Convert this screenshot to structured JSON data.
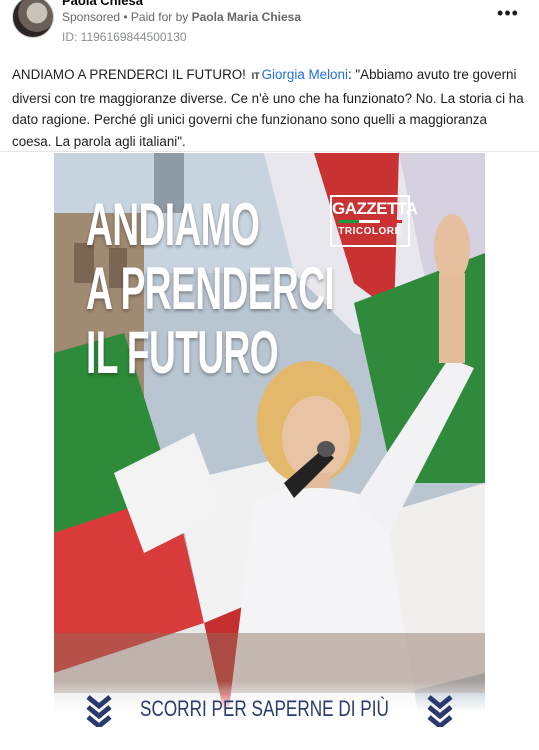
{
  "post": {
    "author": "Paola Chiesa",
    "sponsored": "Sponsored",
    "separator": " • ",
    "paid_for_prefix": "Paid for by ",
    "paid_for_name": "Paola Maria Chiesa",
    "ad_id": "ID: 1196169844500130",
    "more_label": "•••",
    "text_before_link": "ANDIAMO A PRENDERCI IL FUTURO! ",
    "flag": "IT",
    "link_text": "Giorgia Meloni",
    "text_after_link": ": \"Abbiamo avuto tre governi diversi con tre maggioranze diverse. Ce n'è uno che ha funzionato? No. La storia ci ha dato ragione. Perché gli unici governi che funzionano sono quelli a maggioranza coesa. La parola agli italiani\"."
  },
  "creative": {
    "headline_lines": [
      "ANDIAMO",
      "A PRENDERCI",
      "IL FUTURO"
    ],
    "logo_line1": "GAZZETTA",
    "logo_line2": "TRICOLORE",
    "cta": "SCORRI PER SAPERNE DI PIÙ"
  },
  "colors": {
    "link": "#216fdb",
    "flag_green": "#1a9c3e",
    "flag_red": "#d62b2b",
    "cta_navy": "#2a3a6e"
  },
  "icons": {
    "more": "more-horizontal-icon",
    "cta_left": "chevron-down-double-icon",
    "cta_right": "chevron-down-double-icon"
  }
}
